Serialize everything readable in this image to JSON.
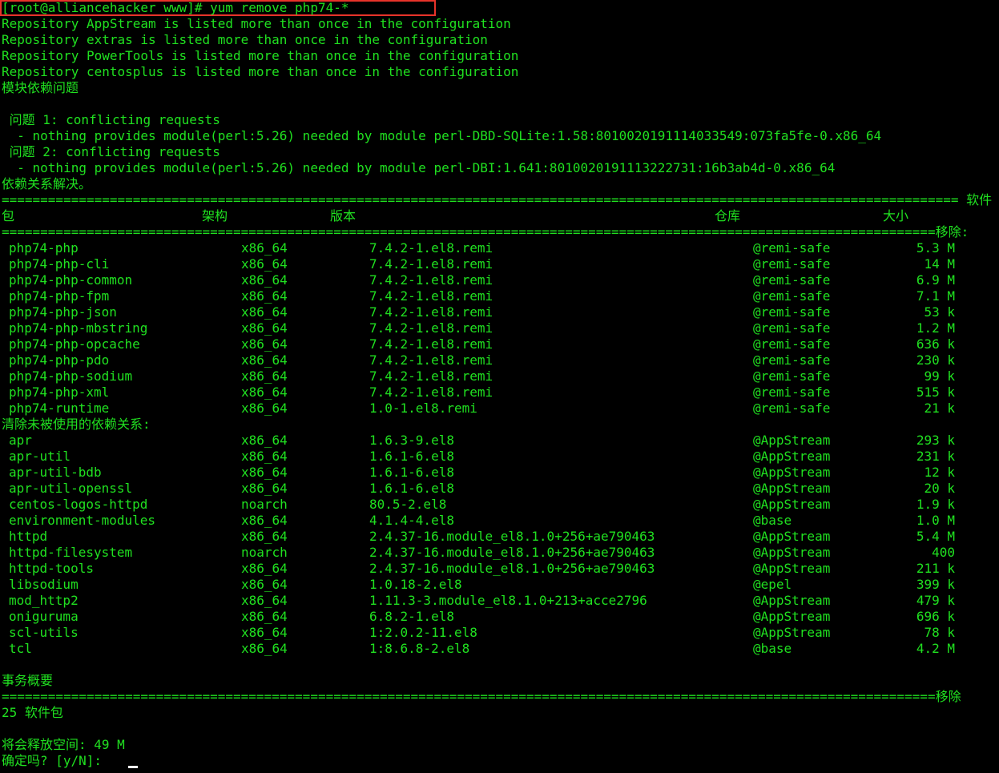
{
  "window": {
    "title": "yum remove php74-*"
  },
  "colors": {
    "background": "#000000",
    "text": "#20e020",
    "highlight": "#e8332a",
    "cursor": "#ffffff"
  },
  "prompt": {
    "text": "[root@alliancehacker www]# yum remove php74-*"
  },
  "messages": [
    "Repository AppStream is listed more than once in the configuration",
    "Repository extras is listed more than once in the configuration",
    "Repository PowerTools is listed more than once in the configuration",
    "Repository centosplus is listed more than once in the configuration",
    "模块依赖问题",
    " 问题 1: conflicting requests",
    "  - nothing provides module(perl:5.26) needed by module perl-DBD-SQLite:1.58:8010020191114033549:073fa5fe-0.x86_64",
    " 问题 2: conflicting requests",
    "  - nothing provides module(perl:5.26) needed by module perl-DBI:1.641:8010020191113222731:16b3ab4d-0.x86_64",
    "依赖关系解决。"
  ],
  "separator_top": "============================================================================================================================ 软件",
  "headers": {
    "package": "包",
    "arch": "架构",
    "version": "版本",
    "repo": "仓库",
    "size": "大小"
  },
  "separator_mid": "=========================================================================================================================移除:",
  "removing": [
    {
      "package": "php74-php",
      "arch": "x86_64",
      "version": "7.4.2-1.el8.remi",
      "repo": "@remi-safe",
      "size": "5.3 M"
    },
    {
      "package": "php74-php-cli",
      "arch": "x86_64",
      "version": "7.4.2-1.el8.remi",
      "repo": "@remi-safe",
      "size": "14 M"
    },
    {
      "package": "php74-php-common",
      "arch": "x86_64",
      "version": "7.4.2-1.el8.remi",
      "repo": "@remi-safe",
      "size": "6.9 M"
    },
    {
      "package": "php74-php-fpm",
      "arch": "x86_64",
      "version": "7.4.2-1.el8.remi",
      "repo": "@remi-safe",
      "size": "7.1 M"
    },
    {
      "package": "php74-php-json",
      "arch": "x86_64",
      "version": "7.4.2-1.el8.remi",
      "repo": "@remi-safe",
      "size": "53 k"
    },
    {
      "package": "php74-php-mbstring",
      "arch": "x86_64",
      "version": "7.4.2-1.el8.remi",
      "repo": "@remi-safe",
      "size": "1.2 M"
    },
    {
      "package": "php74-php-opcache",
      "arch": "x86_64",
      "version": "7.4.2-1.el8.remi",
      "repo": "@remi-safe",
      "size": "636 k"
    },
    {
      "package": "php74-php-pdo",
      "arch": "x86_64",
      "version": "7.4.2-1.el8.remi",
      "repo": "@remi-safe",
      "size": "230 k"
    },
    {
      "package": "php74-php-sodium",
      "arch": "x86_64",
      "version": "7.4.2-1.el8.remi",
      "repo": "@remi-safe",
      "size": "99 k"
    },
    {
      "package": "php74-php-xml",
      "arch": "x86_64",
      "version": "7.4.2-1.el8.remi",
      "repo": "@remi-safe",
      "size": "515 k"
    },
    {
      "package": "php74-runtime",
      "arch": "x86_64",
      "version": "1.0-1.el8.remi",
      "repo": "@remi-safe",
      "size": "21 k"
    }
  ],
  "unused_header": "清除未被使用的依赖关系:",
  "unused": [
    {
      "package": "apr",
      "arch": "x86_64",
      "version": "1.6.3-9.el8",
      "repo": "@AppStream",
      "size": "293 k"
    },
    {
      "package": "apr-util",
      "arch": "x86_64",
      "version": "1.6.1-6.el8",
      "repo": "@AppStream",
      "size": "231 k"
    },
    {
      "package": "apr-util-bdb",
      "arch": "x86_64",
      "version": "1.6.1-6.el8",
      "repo": "@AppStream",
      "size": "12 k"
    },
    {
      "package": "apr-util-openssl",
      "arch": "x86_64",
      "version": "1.6.1-6.el8",
      "repo": "@AppStream",
      "size": "20 k"
    },
    {
      "package": "centos-logos-httpd",
      "arch": "noarch",
      "version": "80.5-2.el8",
      "repo": "@AppStream",
      "size": "1.9 k"
    },
    {
      "package": "environment-modules",
      "arch": "x86_64",
      "version": "4.1.4-4.el8",
      "repo": "@base",
      "size": "1.0 M"
    },
    {
      "package": "httpd",
      "arch": "x86_64",
      "version": "2.4.37-16.module_el8.1.0+256+ae790463",
      "repo": "@AppStream",
      "size": "5.4 M"
    },
    {
      "package": "httpd-filesystem",
      "arch": "noarch",
      "version": "2.4.37-16.module_el8.1.0+256+ae790463",
      "repo": "@AppStream",
      "size": "400"
    },
    {
      "package": "httpd-tools",
      "arch": "x86_64",
      "version": "2.4.37-16.module_el8.1.0+256+ae790463",
      "repo": "@AppStream",
      "size": "211 k"
    },
    {
      "package": "libsodium",
      "arch": "x86_64",
      "version": "1.0.18-2.el8",
      "repo": "@epel",
      "size": "399 k"
    },
    {
      "package": "mod_http2",
      "arch": "x86_64",
      "version": "1.11.3-3.module_el8.1.0+213+acce2796",
      "repo": "@AppStream",
      "size": "479 k"
    },
    {
      "package": "oniguruma",
      "arch": "x86_64",
      "version": "6.8.2-1.el8",
      "repo": "@AppStream",
      "size": "696 k"
    },
    {
      "package": "scl-utils",
      "arch": "x86_64",
      "version": "1:2.0.2-11.el8",
      "repo": "@AppStream",
      "size": "78 k"
    },
    {
      "package": "tcl",
      "arch": "x86_64",
      "version": "1:8.6.8-2.el8",
      "repo": "@base",
      "size": "4.2 M"
    }
  ],
  "summary": {
    "title": "事务概要",
    "separator": "=========================================================================================================================移除",
    "count": "25 软件包",
    "freed": "将会释放空间: 49 M",
    "confirm": "确定吗? [y/N]: "
  }
}
